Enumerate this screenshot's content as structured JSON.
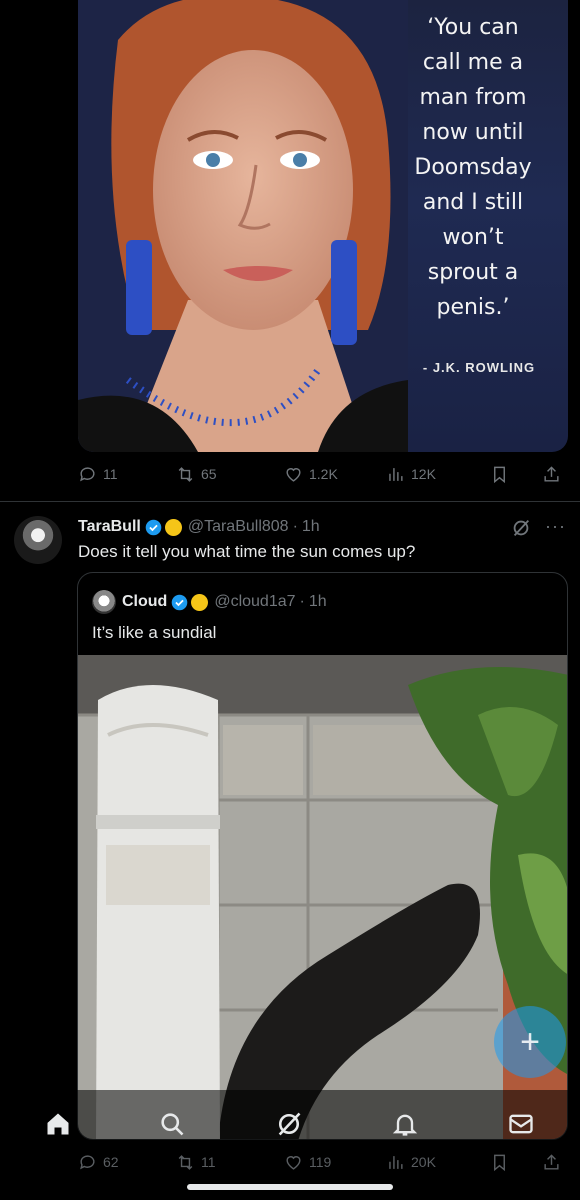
{
  "post1": {
    "quote_text": "‘You can\ncall me a\nman from\nnow until\nDoomsday\nand I still\nwon’t\nsprout a\npenis.’",
    "quote_attribution": "- J.K. ROWLING",
    "actions": {
      "replies": "11",
      "reposts": "65",
      "likes": "1.2K",
      "views": "12K"
    }
  },
  "post2": {
    "author_name": "TaraBull",
    "author_handle": "@TaraBull808",
    "time": "1h",
    "text": "Does it tell you what time the sun comes up?",
    "quoted": {
      "author_name": "Cloud",
      "author_handle": "@cloud1a7",
      "time": "1h",
      "text": "It’s like a sundial"
    },
    "actions": {
      "replies": "62",
      "reposts": "11",
      "likes": "119",
      "views": "20K"
    }
  },
  "icons": {
    "reply": "speech-bubble-icon",
    "repost": "repost-arrows-icon",
    "like": "heart-icon",
    "views": "bar-chart-icon",
    "bookmark": "bookmark-icon",
    "share": "share-icon",
    "tabs": [
      "home-icon",
      "search-icon",
      "grok-icon",
      "bell-icon",
      "mail-icon"
    ],
    "compose": "plus-icon"
  },
  "colors": {
    "background": "#000000",
    "text": "#e7e9ea",
    "muted": "#71767b",
    "accent": "#1d9bf0",
    "gold": "#f5c518"
  }
}
